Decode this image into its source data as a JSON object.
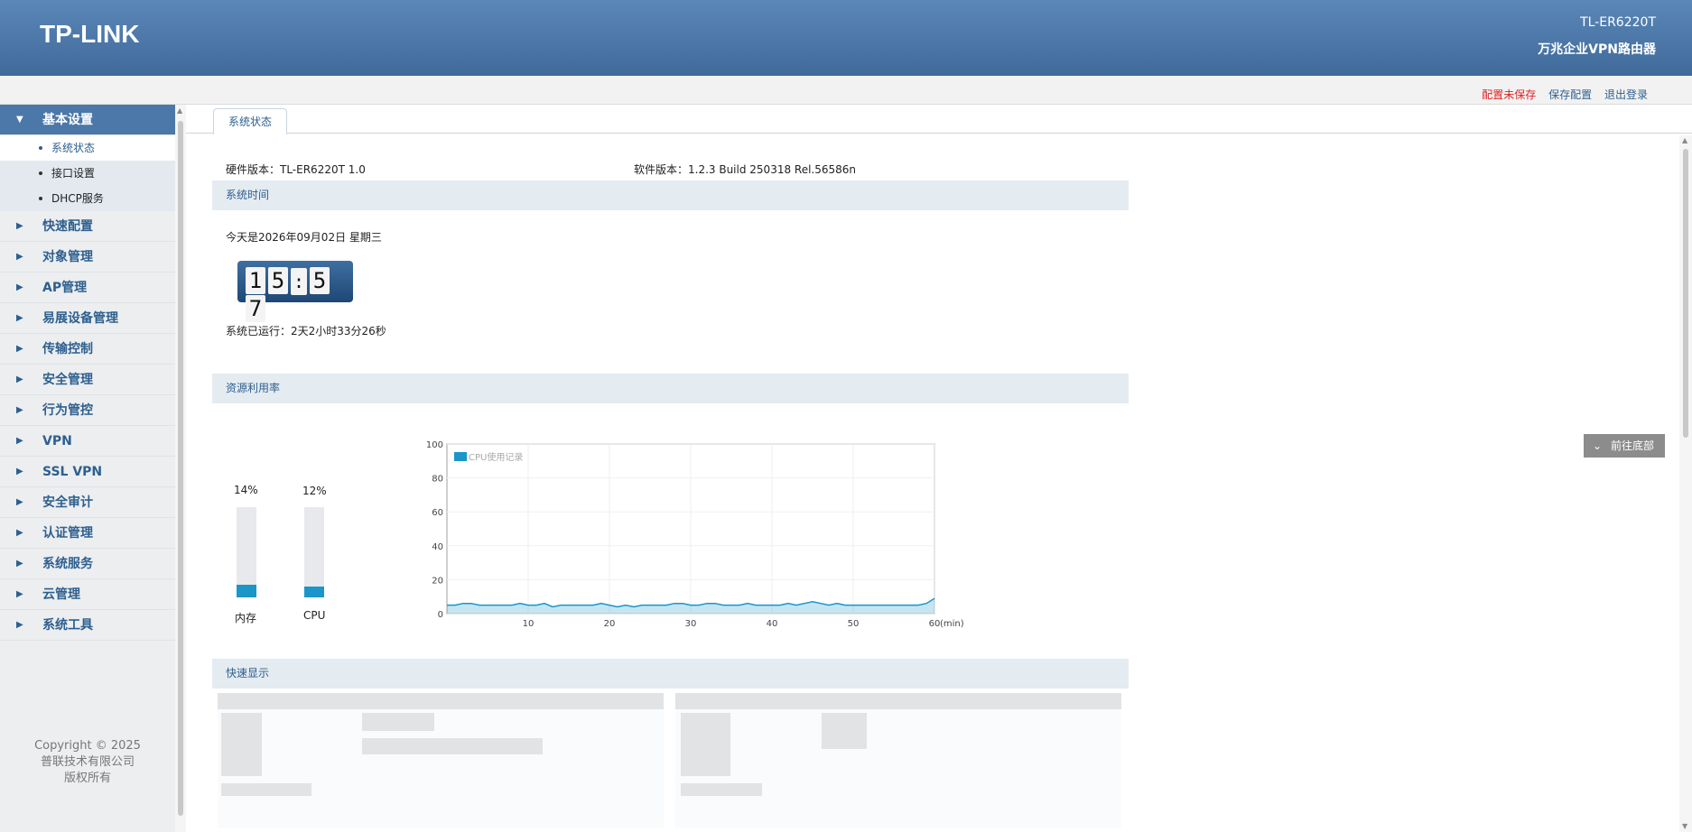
{
  "header": {
    "logo": "TP-LINK",
    "model": "TL-ER6220T",
    "subtitle": "万兆企业VPN路由器"
  },
  "toplinks": {
    "unsaved": "配置未保存",
    "save": "保存配置",
    "logout": "退出登录"
  },
  "sidebar": {
    "items": [
      {
        "label": "基本设置",
        "expanded": true
      },
      {
        "label": "快速配置"
      },
      {
        "label": "对象管理"
      },
      {
        "label": "AP管理"
      },
      {
        "label": "易展设备管理"
      },
      {
        "label": "传输控制"
      },
      {
        "label": "安全管理"
      },
      {
        "label": "行为管控"
      },
      {
        "label": "VPN"
      },
      {
        "label": "SSL VPN"
      },
      {
        "label": "安全审计"
      },
      {
        "label": "认证管理"
      },
      {
        "label": "系统服务"
      },
      {
        "label": "云管理"
      },
      {
        "label": "系统工具"
      }
    ],
    "subitems": [
      {
        "label": "系统状态",
        "current": true
      },
      {
        "label": "接口设置"
      },
      {
        "label": "DHCP服务"
      }
    ],
    "copyright": [
      "Copyright © 2025",
      "普联技术有限公司",
      "版权所有"
    ]
  },
  "tab": {
    "label": "系统状态"
  },
  "status": {
    "hardware": "硬件版本：TL-ER6220T 1.0",
    "software": "软件版本：1.2.3 Build 250318 Rel.56586n",
    "section_time": "系统时间",
    "today": "今天是2026年09月02日 星期三",
    "clock": [
      "1",
      "5",
      ":",
      "5",
      "7"
    ],
    "uptime": "系统已运行：2天2小时33分26秒",
    "section_resource": "资源利用率",
    "memory_pct": "14%",
    "memory_value": 14,
    "memory_label": "内存",
    "cpu_pct": "12%",
    "cpu_value": 12,
    "cpu_label": "CPU",
    "section_quick": "快速显示",
    "go_bottom": "前往底部"
  },
  "chart_data": {
    "type": "line",
    "legend": "CPU使用记录",
    "xlabel": "(min)",
    "xlim": [
      0,
      60
    ],
    "ylim": [
      0,
      100
    ],
    "x_ticks": [
      "10",
      "20",
      "30",
      "40",
      "50",
      "60"
    ],
    "y_ticks": [
      "0",
      "20",
      "40",
      "60",
      "80",
      "100"
    ],
    "series": [
      {
        "name": "CPU使用记录",
        "color": "#1a96c9",
        "x": [
          0,
          1,
          2,
          3,
          4,
          5,
          6,
          7,
          8,
          9,
          10,
          11,
          12,
          13,
          14,
          15,
          16,
          17,
          18,
          19,
          20,
          21,
          22,
          23,
          24,
          25,
          26,
          27,
          28,
          29,
          30,
          31,
          32,
          33,
          34,
          35,
          36,
          37,
          38,
          39,
          40,
          41,
          42,
          43,
          44,
          45,
          46,
          47,
          48,
          49,
          50,
          51,
          52,
          53,
          54,
          55,
          56,
          57,
          58,
          59,
          60
        ],
        "values": [
          5,
          5,
          6,
          6,
          5,
          5,
          5,
          5,
          5,
          6,
          5,
          5,
          6,
          4,
          5,
          5,
          5,
          5,
          5,
          6,
          5,
          4,
          5,
          4,
          5,
          5,
          5,
          5,
          6,
          6,
          5,
          5,
          6,
          6,
          5,
          5,
          5,
          6,
          5,
          5,
          5,
          5,
          6,
          5,
          6,
          7,
          6,
          5,
          6,
          5,
          5,
          5,
          5,
          5,
          5,
          5,
          5,
          5,
          5,
          6,
          9
        ]
      }
    ]
  }
}
